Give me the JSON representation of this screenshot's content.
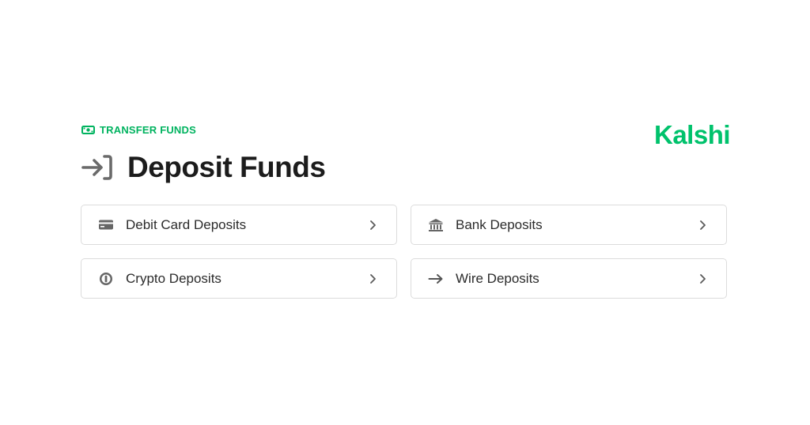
{
  "header": {
    "eyebrow_label": "TRANSFER FUNDS",
    "eyebrow_icon": "money-bill-icon",
    "title": "Deposit Funds",
    "title_icon": "sign-in-arrow-icon",
    "brand": "Kalshi"
  },
  "colors": {
    "accent": "#00b35f",
    "brand": "#00c26c",
    "border": "#dcdcdc",
    "icon": "#666666"
  },
  "options": [
    {
      "label": "Debit Card Deposits",
      "icon": "credit-card-icon"
    },
    {
      "label": "Bank Deposits",
      "icon": "bank-icon"
    },
    {
      "label": "Crypto Deposits",
      "icon": "crypto-coin-icon"
    },
    {
      "label": "Wire Deposits",
      "icon": "arrow-right-icon"
    }
  ]
}
